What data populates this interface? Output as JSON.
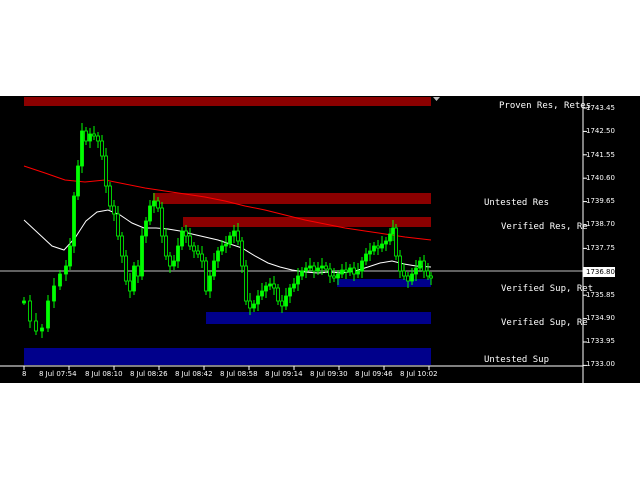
{
  "zone_labels": [
    {
      "key": "proven_res",
      "text": "Proven Res, Retes"
    },
    {
      "key": "untested_res",
      "text": "Untested Res"
    },
    {
      "key": "verified_res",
      "text": "Verified Res, Re"
    },
    {
      "key": "verified_sup_1",
      "text": "Verified Sup, Ret"
    },
    {
      "key": "verified_sup_2",
      "text": "Verified Sup, Re"
    },
    {
      "key": "untested_sup",
      "text": "Untested Sup"
    }
  ],
  "price_axis": [
    "1743.45",
    "1742.50",
    "1741.55",
    "1740.60",
    "1739.65",
    "1738.70",
    "1737.75",
    "1736.80",
    "1735.85",
    "1734.90",
    "1733.95",
    "1733.00"
  ],
  "current_price": "1736.80",
  "time_axis": [
    "8",
    "8 Jul 07:54",
    "8 Jul 08:10",
    "8 Jul 08:26",
    "8 Jul 08:42",
    "8 Jul 08:58",
    "8 Jul 09:14",
    "8 Jul 09:30",
    "8 Jul 09:46",
    "8 Jul 10:02"
  ],
  "colors": {
    "background": "#000000",
    "resistance_zone": "#8b0000",
    "support_zone": "#00008b",
    "candle_up": "#00ff00",
    "ma_slow": "#ff0000",
    "ma_fast": "#ffffff",
    "text": "#ffffff"
  }
}
